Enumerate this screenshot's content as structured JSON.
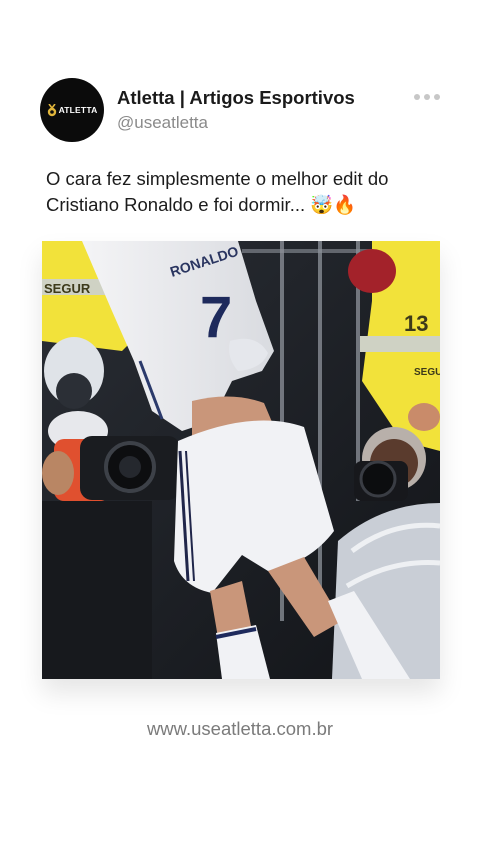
{
  "author": {
    "logo_text": "ATLETTA",
    "display_name": "Atletta | Artigos Esportivos",
    "handle": "@useatletta"
  },
  "post": {
    "caption": "O cara fez simplesmente o melhor edit do Cristiano Ronaldo e foi dormir... 🤯🔥",
    "image": {
      "jersey_name": "RONALDO",
      "jersey_number": "7",
      "vest_text_left": "SEGUR",
      "vest_text_right": "13",
      "vest_text_right_lower": "SEGUR"
    }
  },
  "footer": {
    "url": "www.useatletta.com.br"
  },
  "icons": {
    "more": "more-horizontal-icon",
    "logo": "atletta-logo-icon"
  },
  "colors": {
    "vest_yellow": "#f2e23a",
    "logo_gold": "#e0b53b",
    "handle_gray": "#8a8a8a"
  }
}
